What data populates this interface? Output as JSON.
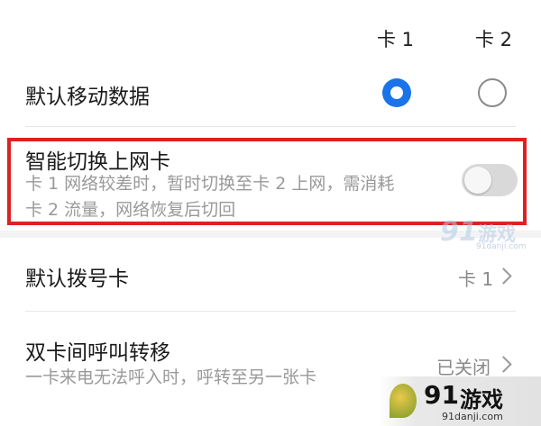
{
  "sim_header": {
    "card1": "卡 1",
    "card2": "卡 2"
  },
  "default_data": {
    "title": "默认移动数据",
    "selected": "card1"
  },
  "smart_switch": {
    "title": "智能切换上网卡",
    "subtitle_line1": "卡 1 网络较差时，暂时切换至卡 2 上网，需消耗",
    "subtitle_line2": "卡 2 流量，网络恢复后切回",
    "enabled": false
  },
  "default_dial": {
    "title": "默认拨号卡",
    "value": "卡 1"
  },
  "call_forward": {
    "title": "双卡间呼叫转移",
    "subtitle": "一卡来电无法呼入时，呼转至另一张卡",
    "value": "已关闭"
  },
  "watermark_top": {
    "num": "91",
    "cn": "游戏",
    "url": "91danji.com"
  },
  "watermark_bottom": {
    "num": "91",
    "cn": "游戏",
    "url": "91danji.com"
  },
  "colors": {
    "accent": "#1a73e8",
    "highlight": "#e02020"
  }
}
